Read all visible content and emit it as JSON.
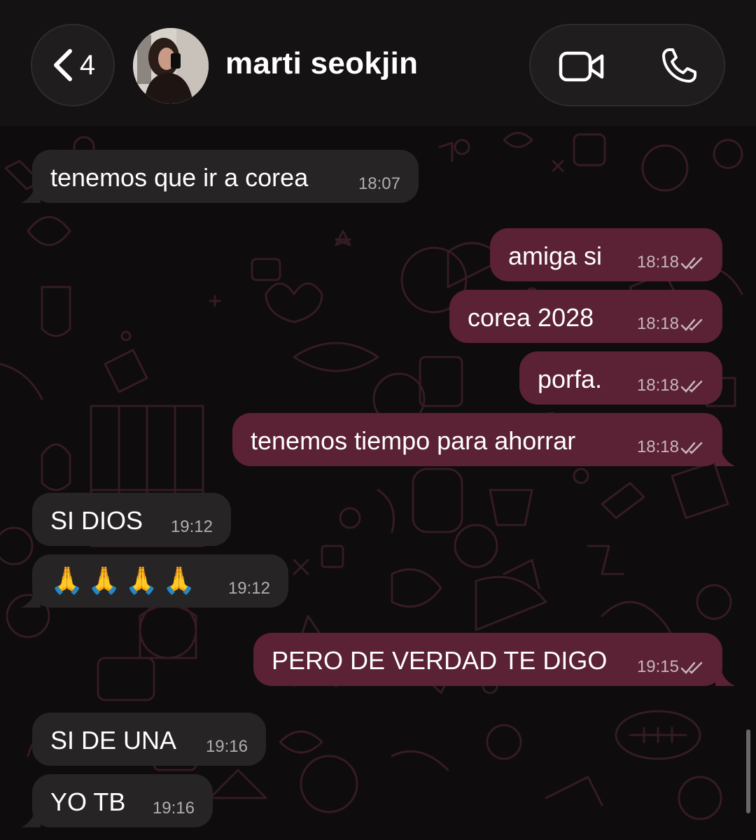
{
  "header": {
    "back_count": "4",
    "contact_name": "marti seokjin"
  },
  "messages": [
    {
      "dir": "in",
      "text": "tenemos que ir a corea",
      "time": "18:07"
    },
    {
      "dir": "out",
      "text": "amiga si",
      "time": "18:18"
    },
    {
      "dir": "out",
      "text": "corea 2028",
      "time": "18:18"
    },
    {
      "dir": "out",
      "text": "porfa.",
      "time": "18:18"
    },
    {
      "dir": "out",
      "text": "tenemos tiempo para ahorrar",
      "time": "18:18"
    },
    {
      "dir": "in",
      "text": "SI DIOS",
      "time": "19:12"
    },
    {
      "dir": "in",
      "text": "🙏🙏🙏🙏",
      "time": "19:12"
    },
    {
      "dir": "out",
      "text": "PERO DE VERDAD TE DIGO",
      "time": "19:15"
    },
    {
      "dir": "in",
      "text": "SI DE UNA",
      "time": "19:16"
    },
    {
      "dir": "in",
      "text": "YO TB",
      "time": "19:16"
    }
  ],
  "icons": {
    "back": "chevron-left-icon",
    "video": "video-camera-icon",
    "phone": "phone-icon",
    "read_receipt": "double-check-icon"
  },
  "colors": {
    "incoming_bubble": "#262425",
    "outgoing_bubble": "#5b2134",
    "wallpaper_doodles": "#3a1d28"
  }
}
